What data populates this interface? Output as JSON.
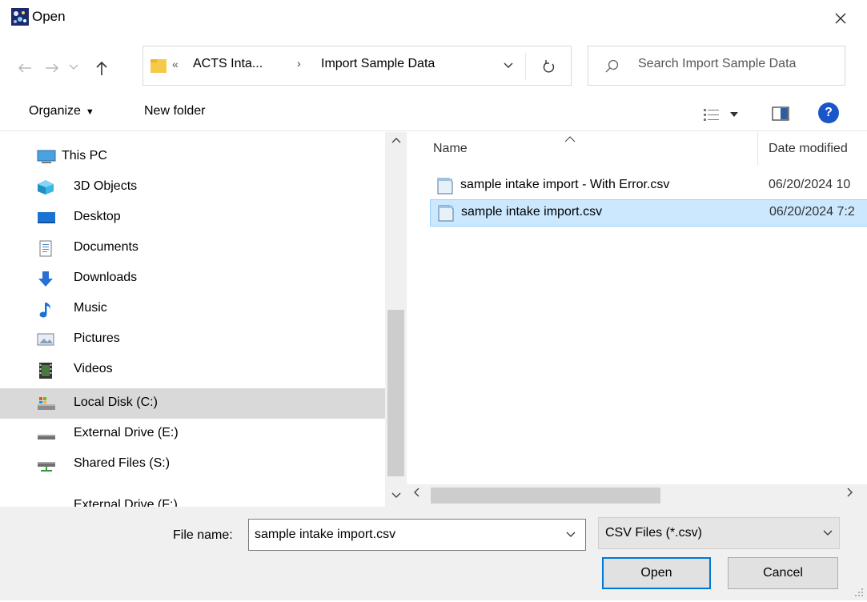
{
  "window": {
    "title": "Open"
  },
  "address": {
    "overflow": "«",
    "segments": [
      "ACTS Inta...",
      "Import Sample Data"
    ],
    "separator": "›"
  },
  "search": {
    "placeholder": "Search Import Sample Data"
  },
  "toolbar": {
    "organize_label": "Organize",
    "new_folder_label": "New folder",
    "help_label": "?"
  },
  "nav": {
    "items": [
      {
        "label": "This PC",
        "icon": "computer-icon"
      },
      {
        "label": "3D Objects",
        "icon": "3d-objects-icon"
      },
      {
        "label": "Desktop",
        "icon": "desktop-icon"
      },
      {
        "label": "Documents",
        "icon": "documents-icon"
      },
      {
        "label": "Downloads",
        "icon": "downloads-icon"
      },
      {
        "label": "Music",
        "icon": "music-icon"
      },
      {
        "label": "Pictures",
        "icon": "pictures-icon"
      },
      {
        "label": "Videos",
        "icon": "videos-icon"
      },
      {
        "label": "Local Disk (C:)",
        "icon": "local-disk-icon",
        "selected": true
      },
      {
        "label": "External Drive (E:)",
        "icon": "drive-icon"
      },
      {
        "label": "Shared Files (S:)",
        "icon": "network-drive-icon"
      },
      {
        "label": "External Drive (F:)",
        "icon": "drive-icon"
      }
    ]
  },
  "files": {
    "columns": {
      "name": "Name",
      "date": "Date modified"
    },
    "rows": [
      {
        "name": "sample intake import - With Error.csv",
        "date": "06/20/2024 10"
      },
      {
        "name": "sample intake import.csv",
        "date": "06/20/2024 7:2",
        "selected": true
      }
    ]
  },
  "bottom": {
    "filename_label": "File name:",
    "filename_value": "sample intake import.csv",
    "filetype_value": "CSV Files (*.csv)",
    "open_label": "Open",
    "cancel_label": "Cancel"
  },
  "colors": {
    "selection": "#cce8ff",
    "selection_border": "#99d1ff",
    "accent": "#0078d7",
    "folder": "#f7c948"
  }
}
